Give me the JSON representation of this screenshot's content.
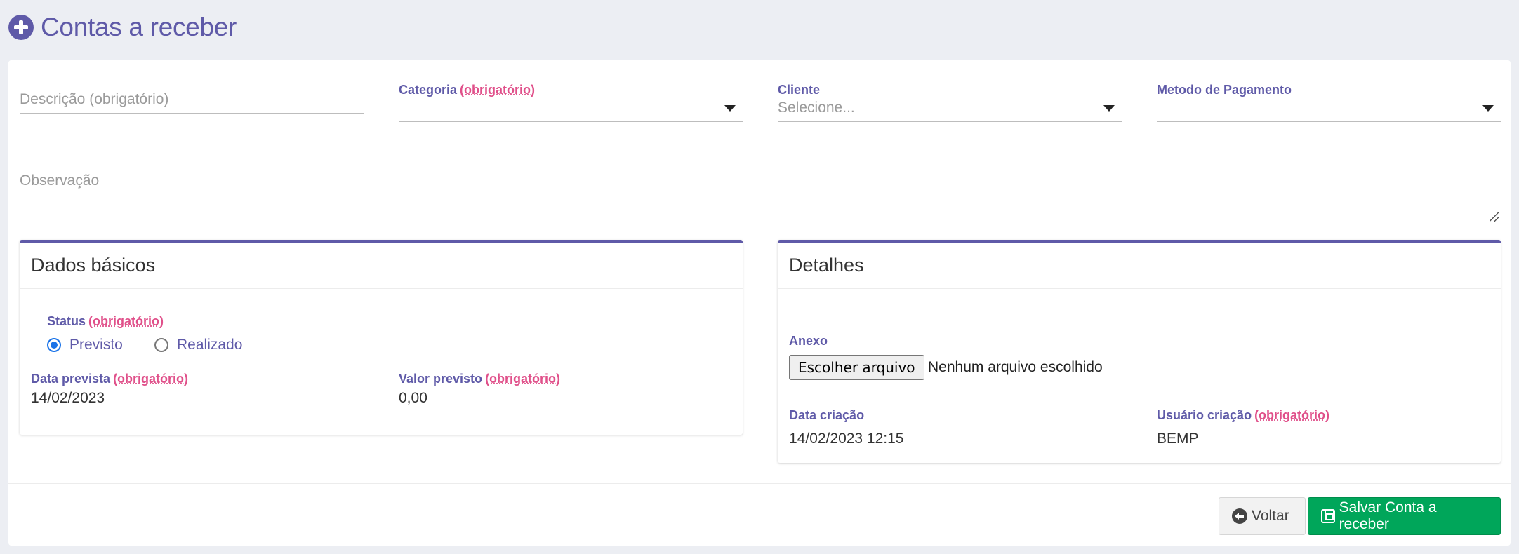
{
  "header": {
    "title": "Contas a receber",
    "icon": "plus-circle-icon"
  },
  "form": {
    "descricao": {
      "placeholder": "Descrição  (obrigatório)",
      "value": ""
    },
    "categoria": {
      "label": "Categoria",
      "required": "(obrigatório)",
      "value": ""
    },
    "cliente": {
      "label": "Cliente",
      "placeholder": "Selecione..."
    },
    "metodo": {
      "label": "Metodo de Pagamento",
      "value": ""
    },
    "observacao": {
      "placeholder": "Observação"
    }
  },
  "dados_basicos": {
    "title": "Dados básicos",
    "status": {
      "label": "Status",
      "required": "(obrigatório)",
      "options": [
        {
          "label": "Previsto",
          "checked": true
        },
        {
          "label": "Realizado",
          "checked": false
        }
      ]
    },
    "data_prevista": {
      "label": "Data prevista",
      "required": "(obrigatório)",
      "value": "14/02/2023"
    },
    "valor_previsto": {
      "label": "Valor previsto",
      "required": "(obrigatório)",
      "value": "0,00"
    }
  },
  "detalhes": {
    "title": "Detalhes",
    "anexo": {
      "label": "Anexo",
      "button": "Escolher arquivo",
      "status": "Nenhum arquivo escolhido"
    },
    "data_criacao": {
      "label": "Data criação",
      "value": "14/02/2023 12:15"
    },
    "usuario_criacao": {
      "label": "Usuário criação",
      "required": "(obrigatório)",
      "value": "BEMP"
    }
  },
  "footer": {
    "back_label": "Voltar",
    "save_label": "Salvar Conta a receber"
  },
  "colors": {
    "accent": "#5f5aa8",
    "required": "#e0508a",
    "save": "#00a65a",
    "background": "#eceef3"
  }
}
